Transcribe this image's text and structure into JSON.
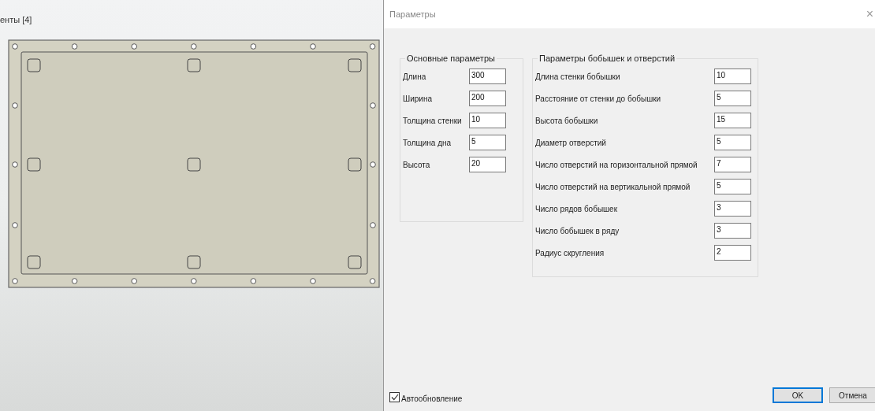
{
  "viewport": {
    "header": "енты [4]"
  },
  "dialog": {
    "title": "Параметры",
    "close": "×",
    "basic_group": {
      "title": "Основные параметры",
      "fields": [
        {
          "label": "Длина",
          "value": "300"
        },
        {
          "label": "Ширина",
          "value": "200"
        },
        {
          "label": "Толщина стенки",
          "value": "10"
        },
        {
          "label": "Толщина дна",
          "value": "5"
        },
        {
          "label": "Высота",
          "value": "20"
        }
      ]
    },
    "boss_group": {
      "title": "Параметры бобышек и отверстий",
      "fields": [
        {
          "label": "Длина стенки бобышки",
          "value": "10"
        },
        {
          "label": "Расстояние от стенки до бобышки",
          "value": "5"
        },
        {
          "label": "Высота бобышки",
          "value": "15"
        },
        {
          "label": "Диаметр отверстий",
          "value": "5"
        },
        {
          "label": "Число отверстий на горизонтальной прямой",
          "value": "7"
        },
        {
          "label": "Число отверстий на вертикальной прямой",
          "value": "5"
        },
        {
          "label": "Число рядов бобышек",
          "value": "3"
        },
        {
          "label": "Число бобышек в ряду",
          "value": "3"
        },
        {
          "label": "Радиус скругления",
          "value": "2"
        }
      ]
    },
    "auto_update": {
      "label": "Автообновление",
      "checked": true
    },
    "buttons": [
      {
        "label": "OK",
        "default": true
      },
      {
        "label": "Отмена",
        "default": false
      }
    ]
  }
}
